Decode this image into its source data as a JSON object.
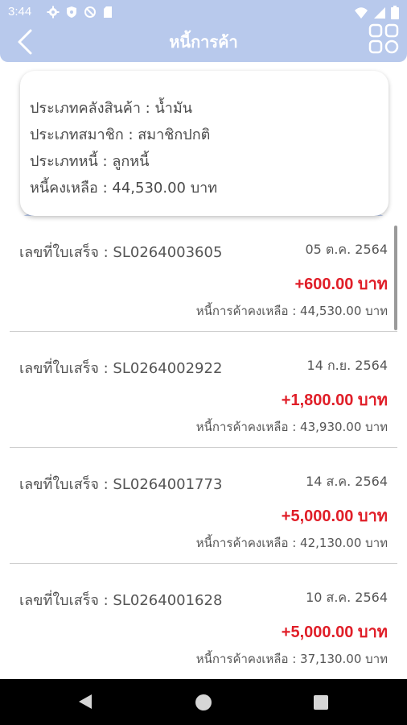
{
  "status_bar": {
    "time": "3:44",
    "left_icons": [
      "gear-icon",
      "shield-icon",
      "no-sync-icon",
      "sd-card-icon"
    ],
    "right_icons": [
      "wifi-icon",
      "signal-icon",
      "battery-icon"
    ]
  },
  "app_bar": {
    "title": "หนี้การค้า",
    "back_icon": "back-arrow-icon",
    "menu_icon": "grid-icon",
    "background": "#b8c9ec"
  },
  "summary": {
    "warehouse_type": "ประเภทคลังสินค้า : น้ำมัน",
    "member_type": "ประเภทสมาชิก : สมาชิกปกติ",
    "debt_type": "ประเภทหนี้ : ลูกหนี้",
    "remaining_debt": "หนี้คงเหลือ : 44,530.00 บาท"
  },
  "invoices": [
    {
      "label": "เลขที่ใบเสร็จ : SL0264003605",
      "date": "05 ต.ค. 2564",
      "amount": "+600.00 บาท",
      "remaining": "หนี้การค้าคงเหลือ : 44,530.00 บาท"
    },
    {
      "label": "เลขที่ใบเสร็จ : SL0264002922",
      "date": "14 ก.ย. 2564",
      "amount": "+1,800.00 บาท",
      "remaining": "หนี้การค้าคงเหลือ : 43,930.00 บาท"
    },
    {
      "label": "เลขที่ใบเสร็จ : SL0264001773",
      "date": "14 ส.ค. 2564",
      "amount": "+5,000.00 บาท",
      "remaining": "หนี้การค้าคงเหลือ : 42,130.00 บาท"
    },
    {
      "label": "เลขที่ใบเสร็จ : SL0264001628",
      "date": "10 ส.ค. 2564",
      "amount": "+5,000.00 บาท",
      "remaining": "หนี้การค้าคงเหลือ : 37,130.00 บาท"
    }
  ],
  "colors": {
    "accent": "#b8c9ec",
    "amount": "#e01e28"
  },
  "nav_bar": {
    "icons": [
      "nav-back-icon",
      "nav-home-icon",
      "nav-recents-icon"
    ]
  }
}
